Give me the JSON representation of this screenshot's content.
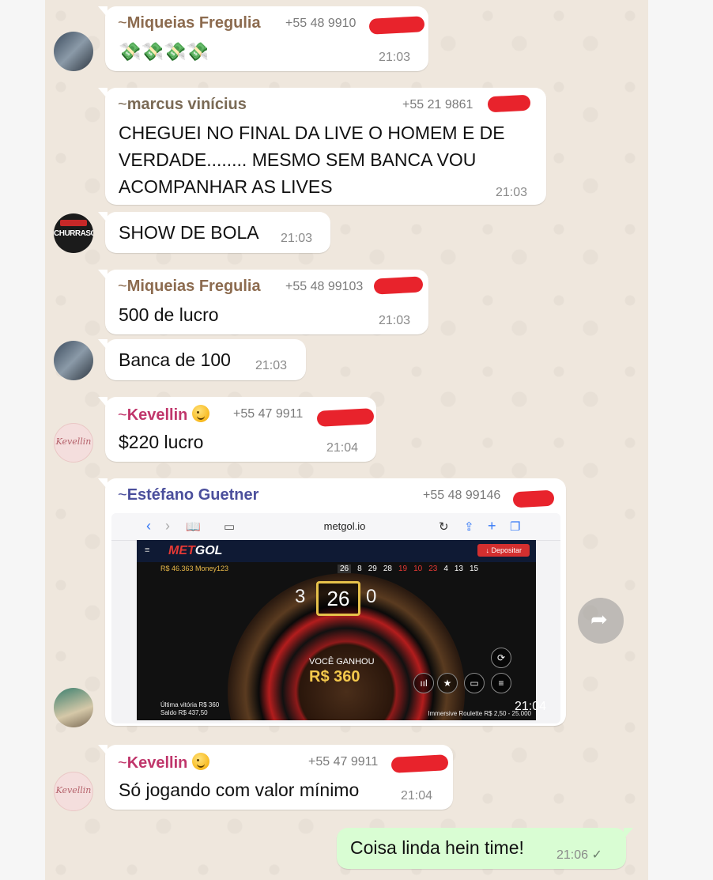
{
  "messages": [
    {
      "sender": "Miqueias Fregulia",
      "phone": "+55 48 9910",
      "text": "💸💸💸💸",
      "time": "21:03"
    },
    {
      "sender": "marcus vinícius",
      "phone": "+55 21 9861",
      "lines": [
        "CHEGUEI NO FINAL DA LIVE O HOMEM E DE",
        "VERDADE........ MESMO SEM BANCA VOU",
        "ACOMPANHAR AS LIVES"
      ],
      "time": "21:03"
    },
    {
      "text": "SHOW DE BOLA",
      "time": "21:03",
      "avatar_label": "CHURRASC"
    },
    {
      "sender": "Miqueias Fregulia",
      "phone": "+55 48 99103",
      "text": "500 de lucro",
      "time": "21:03"
    },
    {
      "text": "Banca de 100",
      "time": "21:03"
    },
    {
      "sender": "Kevellin",
      "phone": "+55 47 9911",
      "text": "$220 lucro",
      "time": "21:04"
    },
    {
      "sender": "Estéfano Guetner",
      "phone": "+55 48 99146",
      "time": "21:04"
    },
    {
      "sender": "Kevellin",
      "phone": "+55 47 9911",
      "text": "Só jogando com valor mínimo",
      "time": "21:04"
    },
    {
      "text": "Coisa linda hein time!",
      "time": "21:06"
    }
  ],
  "avatar_kev_label": "Kevellin",
  "tilde": "~",
  "check": "✓",
  "screenshot": {
    "url": "metgol.io",
    "logo_left": "MET",
    "logo_right": "GOL",
    "deposit_label": "↓ Depositar",
    "balance_top": "R$ 46.363 Money123",
    "numbers": [
      "26",
      "8",
      "29",
      "28",
      "19",
      "10",
      "23",
      "4",
      "13",
      "15"
    ],
    "result": "26",
    "left_num": "3",
    "right_num": "0",
    "won_label": "VOCÊ GANHOU",
    "won_value": "R$ 360",
    "last_win": "Última vitória R$ 360",
    "saldo": "Saldo R$ 437,50",
    "roulette": "Immersive Roulette  R$ 2,50 - 25.000"
  },
  "colors": {
    "miqueias": "#8c6b4f",
    "marcus": "#7a6a55",
    "kevellin": "#c0366b",
    "estefano": "#4b4f9c",
    "bubble_in": "#ffffff",
    "bubble_out": "#d9fdd3",
    "redact": "#e8232c"
  }
}
